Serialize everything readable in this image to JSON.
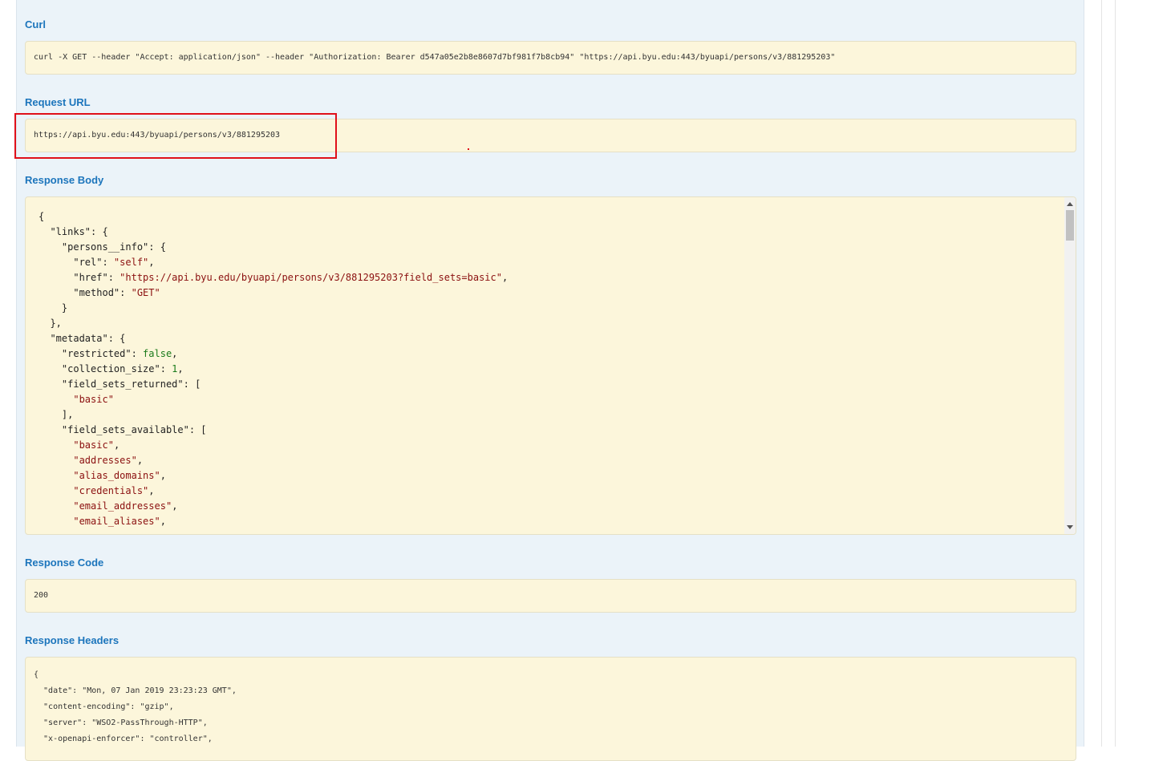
{
  "curl": {
    "heading": "Curl",
    "command": "curl -X GET --header \"Accept: application/json\" --header \"Authorization: Bearer d547a05e2b8e8607d7bf981f7b8cb94\" \"https://api.byu.edu:443/byuapi/persons/v3/881295203\""
  },
  "request_url": {
    "heading": "Request URL",
    "value": "https://api.byu.edu:443/byuapi/persons/v3/881295203"
  },
  "response_body": {
    "heading": "Response Body",
    "lines": [
      [
        [
          "p",
          "{"
        ]
      ],
      [
        [
          "p",
          "  \"links\": {"
        ]
      ],
      [
        [
          "p",
          "    \"persons__info\": {"
        ]
      ],
      [
        [
          "p",
          "      \"rel\": "
        ],
        [
          "s",
          "\"self\""
        ],
        [
          "p",
          ","
        ]
      ],
      [
        [
          "p",
          "      \"href\": "
        ],
        [
          "s",
          "\"https://api.byu.edu/byuapi/persons/v3/881295203?field_sets=basic\""
        ],
        [
          "p",
          ","
        ]
      ],
      [
        [
          "p",
          "      \"method\": "
        ],
        [
          "s",
          "\"GET\""
        ]
      ],
      [
        [
          "p",
          "    }"
        ]
      ],
      [
        [
          "p",
          "  },"
        ]
      ],
      [
        [
          "p",
          "  \"metadata\": {"
        ]
      ],
      [
        [
          "p",
          "    \"restricted\": "
        ],
        [
          "n",
          "false"
        ],
        [
          "p",
          ","
        ]
      ],
      [
        [
          "p",
          "    \"collection_size\": "
        ],
        [
          "n",
          "1"
        ],
        [
          "p",
          ","
        ]
      ],
      [
        [
          "p",
          "    \"field_sets_returned\": ["
        ]
      ],
      [
        [
          "p",
          "      "
        ],
        [
          "s",
          "\"basic\""
        ]
      ],
      [
        [
          "p",
          "    ],"
        ]
      ],
      [
        [
          "p",
          "    \"field_sets_available\": ["
        ]
      ],
      [
        [
          "p",
          "      "
        ],
        [
          "s",
          "\"basic\""
        ],
        [
          "p",
          ","
        ]
      ],
      [
        [
          "p",
          "      "
        ],
        [
          "s",
          "\"addresses\""
        ],
        [
          "p",
          ","
        ]
      ],
      [
        [
          "p",
          "      "
        ],
        [
          "s",
          "\"alias_domains\""
        ],
        [
          "p",
          ","
        ]
      ],
      [
        [
          "p",
          "      "
        ],
        [
          "s",
          "\"credentials\""
        ],
        [
          "p",
          ","
        ]
      ],
      [
        [
          "p",
          "      "
        ],
        [
          "s",
          "\"email_addresses\""
        ],
        [
          "p",
          ","
        ]
      ],
      [
        [
          "p",
          "      "
        ],
        [
          "s",
          "\"email_aliases\""
        ],
        [
          "p",
          ","
        ]
      ]
    ]
  },
  "response_code": {
    "heading": "Response Code",
    "value": "200"
  },
  "response_headers": {
    "heading": "Response Headers",
    "lines": [
      "{",
      "  \"date\": \"Mon, 07 Jan 2019 23:23:23 GMT\",",
      "  \"content-encoding\": \"gzip\",",
      "  \"server\": \"WSO2-PassThrough-HTTP\",",
      "  \"x-openapi-enforcer\": \"controller\","
    ]
  },
  "colors": {
    "heading": "#1c75bc",
    "panel_bg": "#ebf3f9",
    "code_bg": "#fcf6db",
    "json_string": "#8b1010",
    "json_literal": "#1a7a1a",
    "highlight_border": "#e0101a"
  },
  "icons": [
    "scroll-up-arrow-icon",
    "scroll-down-arrow-icon"
  ]
}
